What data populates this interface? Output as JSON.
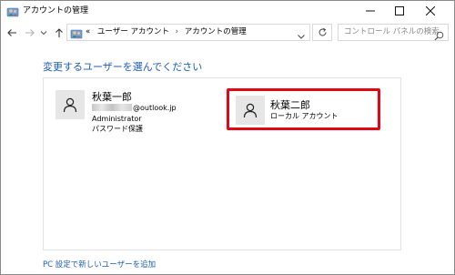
{
  "window": {
    "title": "アカウントの管理",
    "controls": {
      "minimize": "—",
      "maximize": "☐",
      "close": "✕"
    }
  },
  "navbar": {
    "back": "←",
    "forward": "→",
    "up": "↑",
    "address_prefix": "«",
    "breadcrumbs": [
      "ユーザー アカウント",
      "アカウントの管理"
    ],
    "separator": "›",
    "search_placeholder": "コントロール パネルの検索"
  },
  "main": {
    "heading": "変更するユーザーを選んでください",
    "accounts": [
      {
        "name": "秋葉一郎",
        "email_suffix": "@outlook.jp",
        "role": "Administrator",
        "status": "パスワード保護"
      },
      {
        "name": "秋葉二郎",
        "type": "ローカル アカウント",
        "highlighted": true
      }
    ],
    "footer_link": "PC 設定で新しいユーザーを追加"
  },
  "colors": {
    "accent_link": "#1e5cb3",
    "highlight_frame": "#e30613",
    "avatar_bg": "#e6e6e6"
  },
  "icons": {
    "app": "user-accounts-icon",
    "avatar": "user-silhouette-icon",
    "refresh": "refresh-icon",
    "search": "search-icon"
  }
}
